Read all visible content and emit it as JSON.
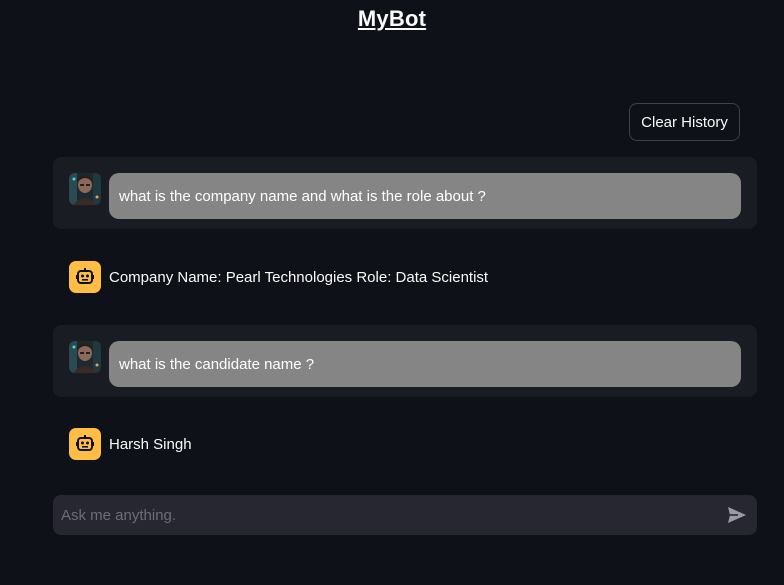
{
  "header": {
    "title": "MyBot"
  },
  "toolbar": {
    "clear_label": "Clear History"
  },
  "messages": [
    {
      "role": "user",
      "text": "what is the company name and what is the role about ?",
      "avatar_icon": "user-photo-icon"
    },
    {
      "role": "assistant",
      "text": "Company Name: Pearl Technologies Role: Data Scientist",
      "avatar_icon": "robot-icon"
    },
    {
      "role": "user",
      "text": "what is the candidate name ?",
      "avatar_icon": "user-photo-icon"
    },
    {
      "role": "assistant",
      "text": "Harsh Singh",
      "avatar_icon": "robot-icon"
    }
  ],
  "chat_input": {
    "placeholder": "Ask me anything.",
    "value": "",
    "send_icon": "send-icon"
  },
  "colors": {
    "background": "#0e1117",
    "user_row": "#1a1c24",
    "user_bubble": "#858585",
    "bot_avatar": "#ffbd45",
    "input_bg": "#262730"
  }
}
